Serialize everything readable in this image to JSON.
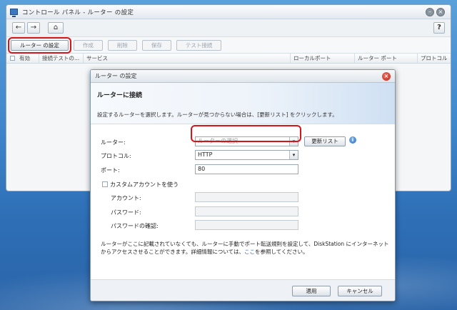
{
  "window": {
    "title": "コントロール パネル - ルーター の設定",
    "back_glyph": "←",
    "forward_glyph": "→",
    "home_glyph": "⌂",
    "help_glyph": "?",
    "minimize_glyph": "–",
    "close_glyph": "×"
  },
  "toolbar": {
    "router_settings": "ルーター の設定",
    "create": "作成",
    "delete": "削除",
    "save": "保存",
    "test_connection": "テスト接続"
  },
  "grid": {
    "columns": [
      "有効",
      "接続テストの...",
      "サービス",
      "ローカルポート",
      "ルーター ポート",
      "プロトコル"
    ]
  },
  "dialog": {
    "title": "ルーター の設定",
    "close_glyph": "×",
    "heading": "ルーターに接続",
    "description": "設定するルーターを選択します。ルーターが見つからない場合は、[更新リスト] をクリックします。",
    "router_label": "ルーター:",
    "router_placeholder": "ルーターの選択",
    "refresh_button": "更新リスト",
    "info_glyph": "i",
    "protocol_label": "プロトコル:",
    "protocol_value": "HTTP",
    "port_label": "ポート:",
    "port_value": "80",
    "custom_account_label": "カスタムアカウントを使う",
    "account_label": "アカウント:",
    "password_label": "パスワード:",
    "password_confirm_label": "パスワードの確認:",
    "note_before_link": "ルーターがここに記載されていなくても、ルーターに手動でポート転送規則を設定して、DiskStation にインターネットからアクセスさせることができます。詳細情報については、",
    "note_link": "ここ",
    "note_after_link": "を参照してください。",
    "apply_button": "適用",
    "cancel_button": "キャンセル",
    "dropdown_glyph": "▾"
  },
  "colors": {
    "highlight": "#d4161c",
    "link": "#1a5cb0"
  }
}
